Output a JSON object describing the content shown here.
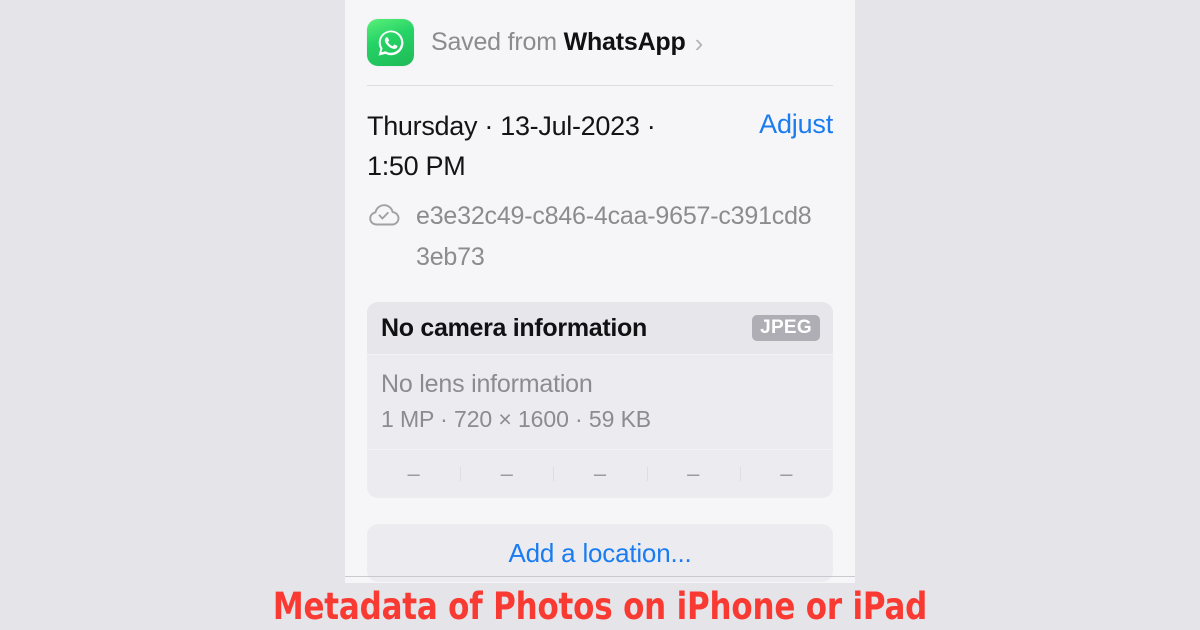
{
  "background": {
    "page_color": "#e4e4e9",
    "panel_color": "#f6f6f8"
  },
  "saved_from": {
    "icon": "whatsapp-icon",
    "prefix": "Saved from ",
    "app_name": "WhatsApp",
    "chevron": "›"
  },
  "date": {
    "text": "Thursday · 13-Jul-2023 · 1:50 PM",
    "adjust_label": "Adjust",
    "adjust_color": "#1a7cf0"
  },
  "asset": {
    "icon": "icloud-checkmark-icon",
    "uuid": "e3e32c49-c846-4caa-9657-c391cd83eb73"
  },
  "camera_card": {
    "camera_title": "No camera information",
    "format_badge": "JPEG",
    "badge_color": "#aeaeb4",
    "lens_title": "No lens information",
    "specs": "1 MP · 720 × 1600 · 59 KB",
    "megapixels": "1 MP",
    "dimensions": "720 × 1600",
    "file_size": "59 KB",
    "exif_values": [
      "–",
      "–",
      "–",
      "–",
      "–"
    ]
  },
  "location": {
    "add_label": "Add a location...",
    "color": "#1a7cf0"
  },
  "caption": {
    "text": "Metadata of Photos on iPhone or iPad",
    "color": "#f93a33"
  }
}
